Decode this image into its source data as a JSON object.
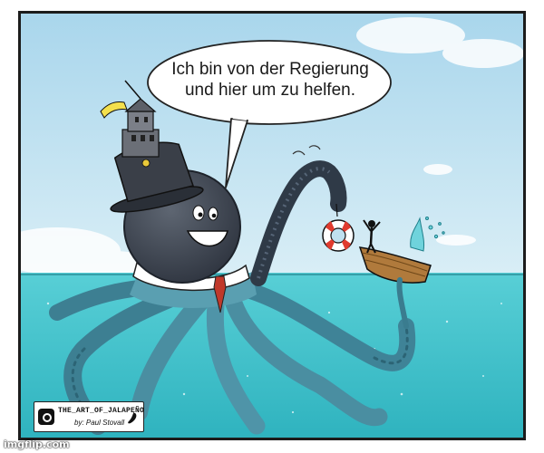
{
  "speech_bubble": {
    "line1": "Ich bin von der Regierung",
    "line2": "und hier um zu helfen."
  },
  "signature": {
    "handle": "THE_ART_OF_JALAPEÑO",
    "artist": "by: Paul Stovall"
  },
  "watermark": "imgflip.com",
  "colors": {
    "sky": "#bfe0f0",
    "sea": "#47c4cc",
    "octopus_head": "#3f4652",
    "octopus_arms": "#4f8fa3",
    "panel_border": "#1c1c1c"
  },
  "icons": [
    "speech-bubble",
    "life-ring-icon",
    "flag-icon",
    "instagram-icon",
    "pepper-icon"
  ]
}
